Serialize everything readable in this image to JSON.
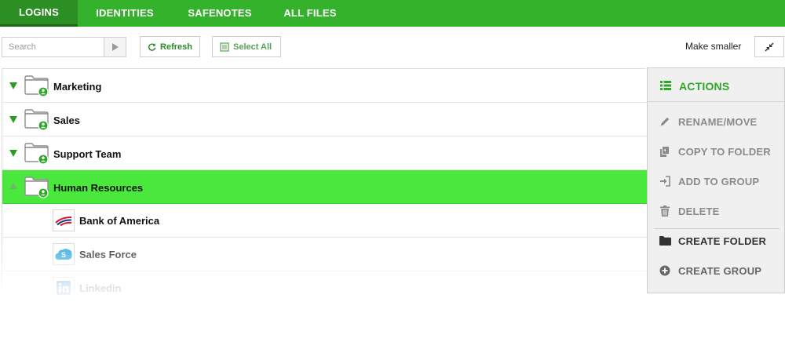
{
  "nav": {
    "tabs": [
      {
        "label": "LOGINS",
        "active": true
      },
      {
        "label": "IDENTITIES",
        "active": false
      },
      {
        "label": "SAFENOTES",
        "active": false
      },
      {
        "label": "ALL FILES",
        "active": false
      }
    ]
  },
  "toolbar": {
    "search_placeholder": "Search",
    "refresh_label": "Refresh",
    "select_all_label": "Select All",
    "make_smaller_label": "Make smaller"
  },
  "list": {
    "folders": [
      {
        "label": "Marketing",
        "expanded": false
      },
      {
        "label": "Sales",
        "expanded": false
      },
      {
        "label": "Support Team",
        "expanded": false
      },
      {
        "label": "Human Resources",
        "expanded": true,
        "selected": true
      }
    ],
    "items": [
      {
        "label": "Bank of America",
        "icon": "bank-of-america-icon"
      },
      {
        "label": "Sales Force",
        "icon": "salesforce-icon"
      },
      {
        "label": "Linkedin",
        "icon": "linkedin-icon"
      }
    ]
  },
  "actions": {
    "title": "ACTIONS",
    "items": [
      {
        "label": "RENAME/MOVE",
        "icon": "pencil-icon",
        "enabled": false
      },
      {
        "label": "COPY TO FOLDER",
        "icon": "copy-icon",
        "enabled": false
      },
      {
        "label": "ADD TO GROUP",
        "icon": "sign-in-icon",
        "enabled": false
      },
      {
        "label": "DELETE",
        "icon": "trash-icon",
        "enabled": false
      },
      {
        "label": "CREATE FOLDER",
        "icon": "folder-icon",
        "enabled": true
      },
      {
        "label": "CREATE GROUP",
        "icon": "plus-circle-icon",
        "enabled": true
      }
    ]
  },
  "colors": {
    "nav_green": "#35b22c",
    "nav_active": "#2b8f23",
    "selected_row": "#4ae83c",
    "accent_text": "#2fa726"
  }
}
